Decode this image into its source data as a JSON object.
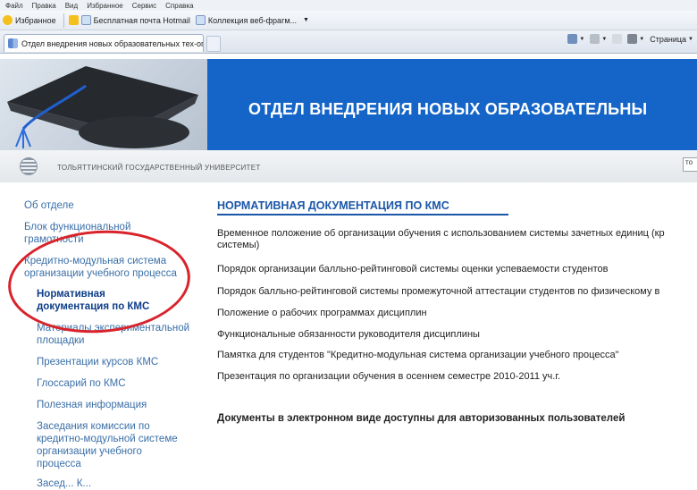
{
  "browser": {
    "menu": [
      "Файл",
      "Правка",
      "Вид",
      "Избранное",
      "Сервис",
      "Справка"
    ],
    "favorites": {
      "label": "Избранное",
      "links": [
        "Бесплатная почта Hotmail",
        "Коллекция веб-фрагм..."
      ]
    },
    "tab": {
      "title": "Отдел внедрения новых образовательных тех-ог..."
    },
    "commands": {
      "page_label": "Страница"
    }
  },
  "banner": {
    "title": "ОТДЕЛ ВНЕДРЕНИЯ НОВЫХ ОБРАЗОВАТЕЛЬНЫ"
  },
  "university": {
    "name": "ТОЛЬЯТТИНСКИЙ ГОСУДАРСТВЕННЫЙ УНИВЕРСИТЕТ",
    "search_value": "то"
  },
  "nav": {
    "about": "Об отделе",
    "block": [
      "Блок функциональной",
      "грамотности"
    ],
    "kms": [
      "Кредитно-модульная система",
      "организации учебного процесса"
    ],
    "active": [
      "Нормативная",
      "документация по КМС"
    ],
    "materials": [
      "Материалы экспериментальной",
      "площадки"
    ],
    "presentations": "Презентации курсов КМС",
    "glossary": "Глоссарий по КМС",
    "useful": "Полезная информация",
    "meetings": [
      "Заседания комиссии по",
      "кредитно-модульной системе",
      "организации учебного",
      "процесса"
    ],
    "more": "Засед... К..."
  },
  "main": {
    "title": "НОРМАТИВНАЯ ДОКУМЕНТАЦИЯ ПО КМС",
    "docs": [
      "Временное положение об организации обучения с использованием системы зачетных единиц (кр",
      "системы)",
      "Порядок организации балльно-рейтинговой системы оценки успеваемости студентов",
      "Порядок балльно-рейтинговой системы промежуточной аттестации студентов по физическому в",
      "Положение о рабочих программах дисциплин",
      "Функциональные обязанности руководителя дисциплины",
      "Памятка для студентов \"Кредитно-модульная система организации учебного процесса\"",
      "Презентация по организации обучения в осеннем семестре 2010-2011 уч.г."
    ],
    "note": "Документы в электронном виде доступны для авторизованных пользователей"
  },
  "colors": {
    "banner_blue": "#1565c8",
    "link": "#3a6fa8",
    "active": "#0d3c88",
    "highlight_oval": "#d8232a"
  }
}
